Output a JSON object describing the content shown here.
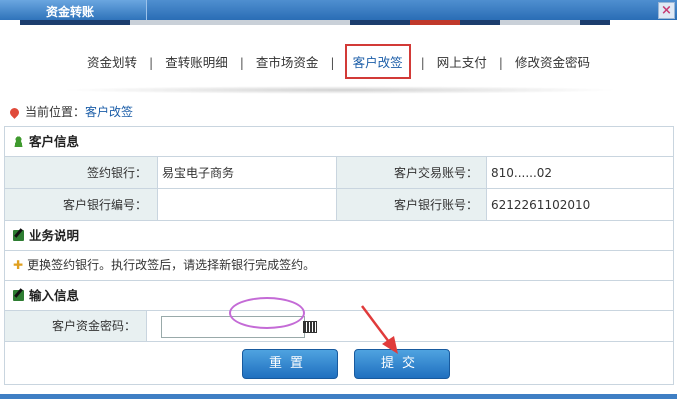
{
  "window": {
    "title": "资金转账",
    "close_glyph": "×"
  },
  "nav": {
    "items": [
      "资金划转",
      "查转账明细",
      "查市场资金",
      "客户改签",
      "网上支付",
      "修改资金密码"
    ],
    "active_index": 3,
    "separator": "|"
  },
  "location": {
    "label": "当前位置：",
    "current": "客户改签"
  },
  "customer_info": {
    "heading": "客户信息",
    "rows": [
      {
        "label1": "签约银行：",
        "value1": "易宝电子商务",
        "label2": "客户交易账号：",
        "value2": "810......02"
      },
      {
        "label1": "客户银行编号：",
        "value1": "",
        "label2": "客户银行账号：",
        "value2": "6212261102010"
      }
    ]
  },
  "business": {
    "heading": "业务说明",
    "text": "更换签约银行。执行改签后，请选择新银行完成签约。"
  },
  "input_info": {
    "heading": "输入信息",
    "password_label": "客户资金密码：",
    "password_value": ""
  },
  "buttons": {
    "reset": "重置",
    "submit": "提交"
  },
  "colors": {
    "title_bar": "#2a6db5",
    "active_border": "#d23a37",
    "label_bg": "#e8f0f1",
    "button": "#1f6fbf"
  }
}
